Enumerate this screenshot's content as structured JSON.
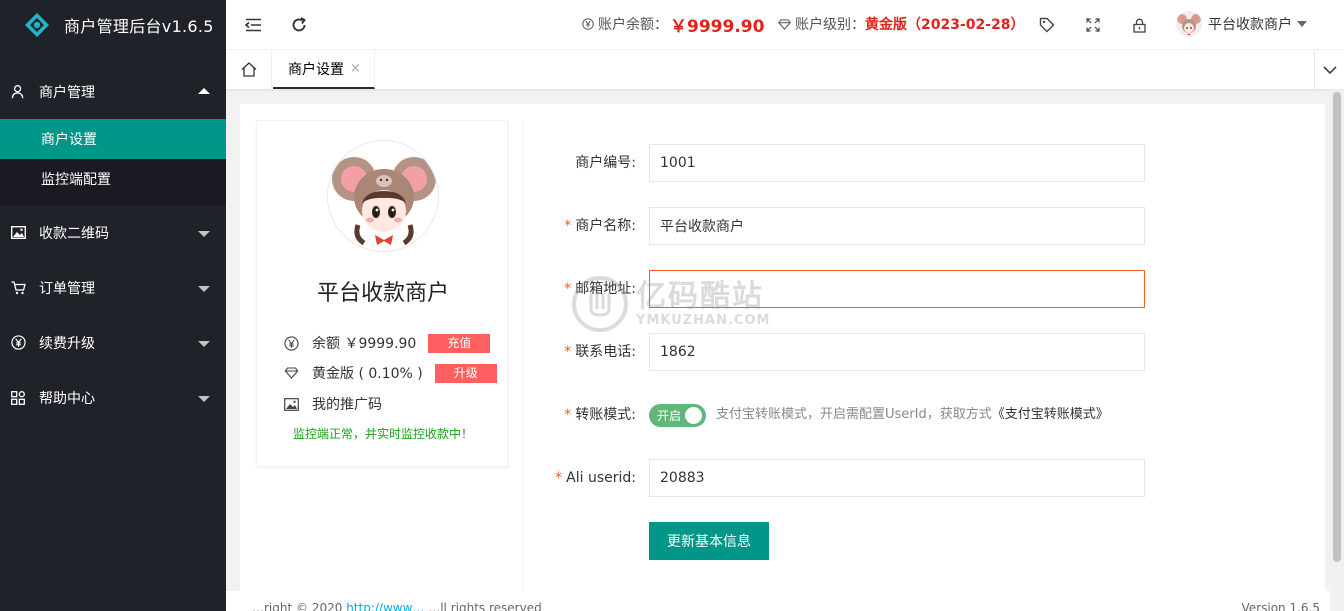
{
  "app": {
    "title": "商户管理后台v1.6.5"
  },
  "sidebar": {
    "items": [
      {
        "label": "商户管理",
        "expanded": true,
        "icon": "user-icon",
        "children": [
          {
            "label": "商户设置",
            "active": true
          },
          {
            "label": "监控端配置",
            "active": false
          }
        ]
      },
      {
        "label": "收款二维码",
        "icon": "image-icon"
      },
      {
        "label": "订单管理",
        "icon": "cart-icon"
      },
      {
        "label": "续费升级",
        "icon": "yen-icon"
      },
      {
        "label": "帮助中心",
        "icon": "grid-icon"
      }
    ]
  },
  "header": {
    "balance_label": "账户余额：",
    "balance_value": "￥9999.90",
    "level_label": "账户级别：",
    "level_value": "黄金版（2023-02-28）",
    "user_name": "平台收款商户"
  },
  "tabs": {
    "items": [
      {
        "label": "商户设置",
        "close": "×"
      }
    ]
  },
  "profile": {
    "name": "平台收款商户",
    "balance_text": "余额 ￥9999.90",
    "recharge_label": "充值",
    "level_text": "黄金版 ( 0.10% )",
    "upgrade_label": "升级",
    "promo_text": "我的推广码",
    "status_text": "监控端正常，并实时监控收款中！"
  },
  "form": {
    "merchant_id": {
      "label": "商户编号:",
      "value": "1001",
      "required": false
    },
    "merchant_name": {
      "label": "商户名称:",
      "value": "平台收款商户",
      "required": true
    },
    "email": {
      "label": "邮箱地址:",
      "value": "",
      "required": true
    },
    "phone": {
      "label": "联系电话:",
      "value": "1862",
      "required": true
    },
    "transfer_mode": {
      "label": "转账模式:",
      "switch_label": "开启",
      "switch_on": true,
      "desc": "支付宝转账模式，开启需配置UserId，获取方式",
      "desc_link": "《支付宝转账模式》",
      "required": true
    },
    "ali_userid": {
      "label": "Ali userid:",
      "value": "20883",
      "required": true
    },
    "submit_label": "更新基本信息"
  },
  "watermark": {
    "cn": "亿码酷站",
    "en": "YMKUZHAN.COM"
  },
  "footer": {
    "left_prefix": "…right © 2020 ",
    "left_link": "http://www…",
    "left_suffix": " …ll rights reserved",
    "right": "Version 1.6.5"
  },
  "colors": {
    "accent": "#009688",
    "sidebar": "#20222a",
    "danger": "#e2231a",
    "pink_button": "#ff5f5f",
    "switch_on": "#5fb878",
    "status_green": "#18a317"
  }
}
